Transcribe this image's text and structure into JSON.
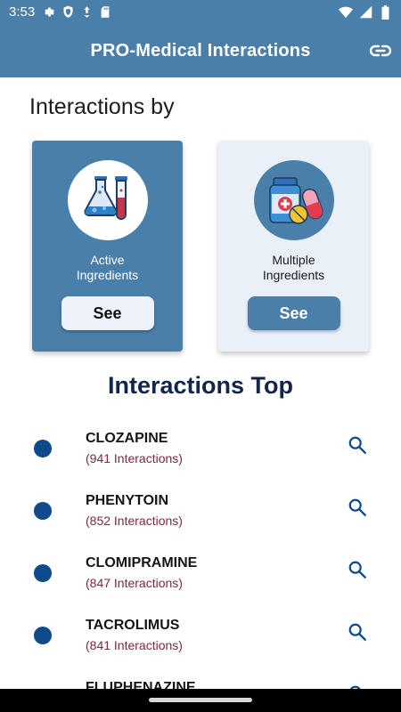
{
  "status_bar": {
    "time": "3:53",
    "left_icons": [
      "gear-icon",
      "shield-icon",
      "usb-download-icon",
      "sd-card-icon"
    ],
    "right_icons": [
      "wifi-icon",
      "signal-icon",
      "battery-icon"
    ]
  },
  "app_bar": {
    "title": "PRO-Medical Interactions",
    "action_icon": "link-icon"
  },
  "section_heading": "Interactions by",
  "cards": [
    {
      "id": "active",
      "label_line1": "Active",
      "label_line2": "Ingredients",
      "button": "See",
      "icon": "lab-flasks-icon"
    },
    {
      "id": "multi",
      "label_line1": "Multiple",
      "label_line2": "Ingredients",
      "button": "See",
      "icon": "pills-bottle-icon"
    }
  ],
  "top_heading": "Interactions Top",
  "top_list": [
    {
      "name": "CLOZAPINE",
      "count": "(941 Interactions)"
    },
    {
      "name": "PHENYTOIN",
      "count": "(852 Interactions)"
    },
    {
      "name": "CLOMIPRAMINE",
      "count": "(847 Interactions)"
    },
    {
      "name": "TACROLIMUS",
      "count": "(841 Interactions)"
    },
    {
      "name": "FLUPHENAZINE",
      "count": ""
    }
  ],
  "colors": {
    "primary": "#4a7fa9",
    "light_card": "#e9f0f8",
    "dot": "#0e4a8c",
    "count_text": "#7a2a3a",
    "heading": "#13254a"
  }
}
